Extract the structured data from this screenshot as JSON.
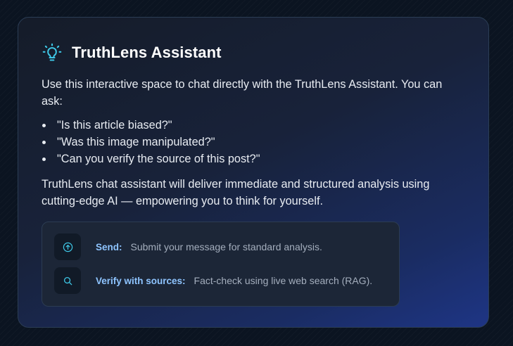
{
  "assistant": {
    "title": "TruthLens Assistant",
    "icon": "lightbulb-icon",
    "accent_color": "#3ec7e6",
    "intro": "Use this interactive space to chat directly with the TruthLens Assistant. You can ask:",
    "examples": [
      "\"Is this article biased?\"",
      "\"Was this image manipulated?\"",
      "\"Can you verify the source of this post?\""
    ],
    "outro": "TruthLens chat assistant will deliver immediate and structured analysis using cutting-edge AI — empowering you to think for yourself."
  },
  "actions": [
    {
      "icon": "send-icon",
      "label": "Send:",
      "description": "Submit your message for standard analysis."
    },
    {
      "icon": "search-icon",
      "label": "Verify with sources:",
      "description": "Fact-check using live web search (RAG)."
    }
  ]
}
